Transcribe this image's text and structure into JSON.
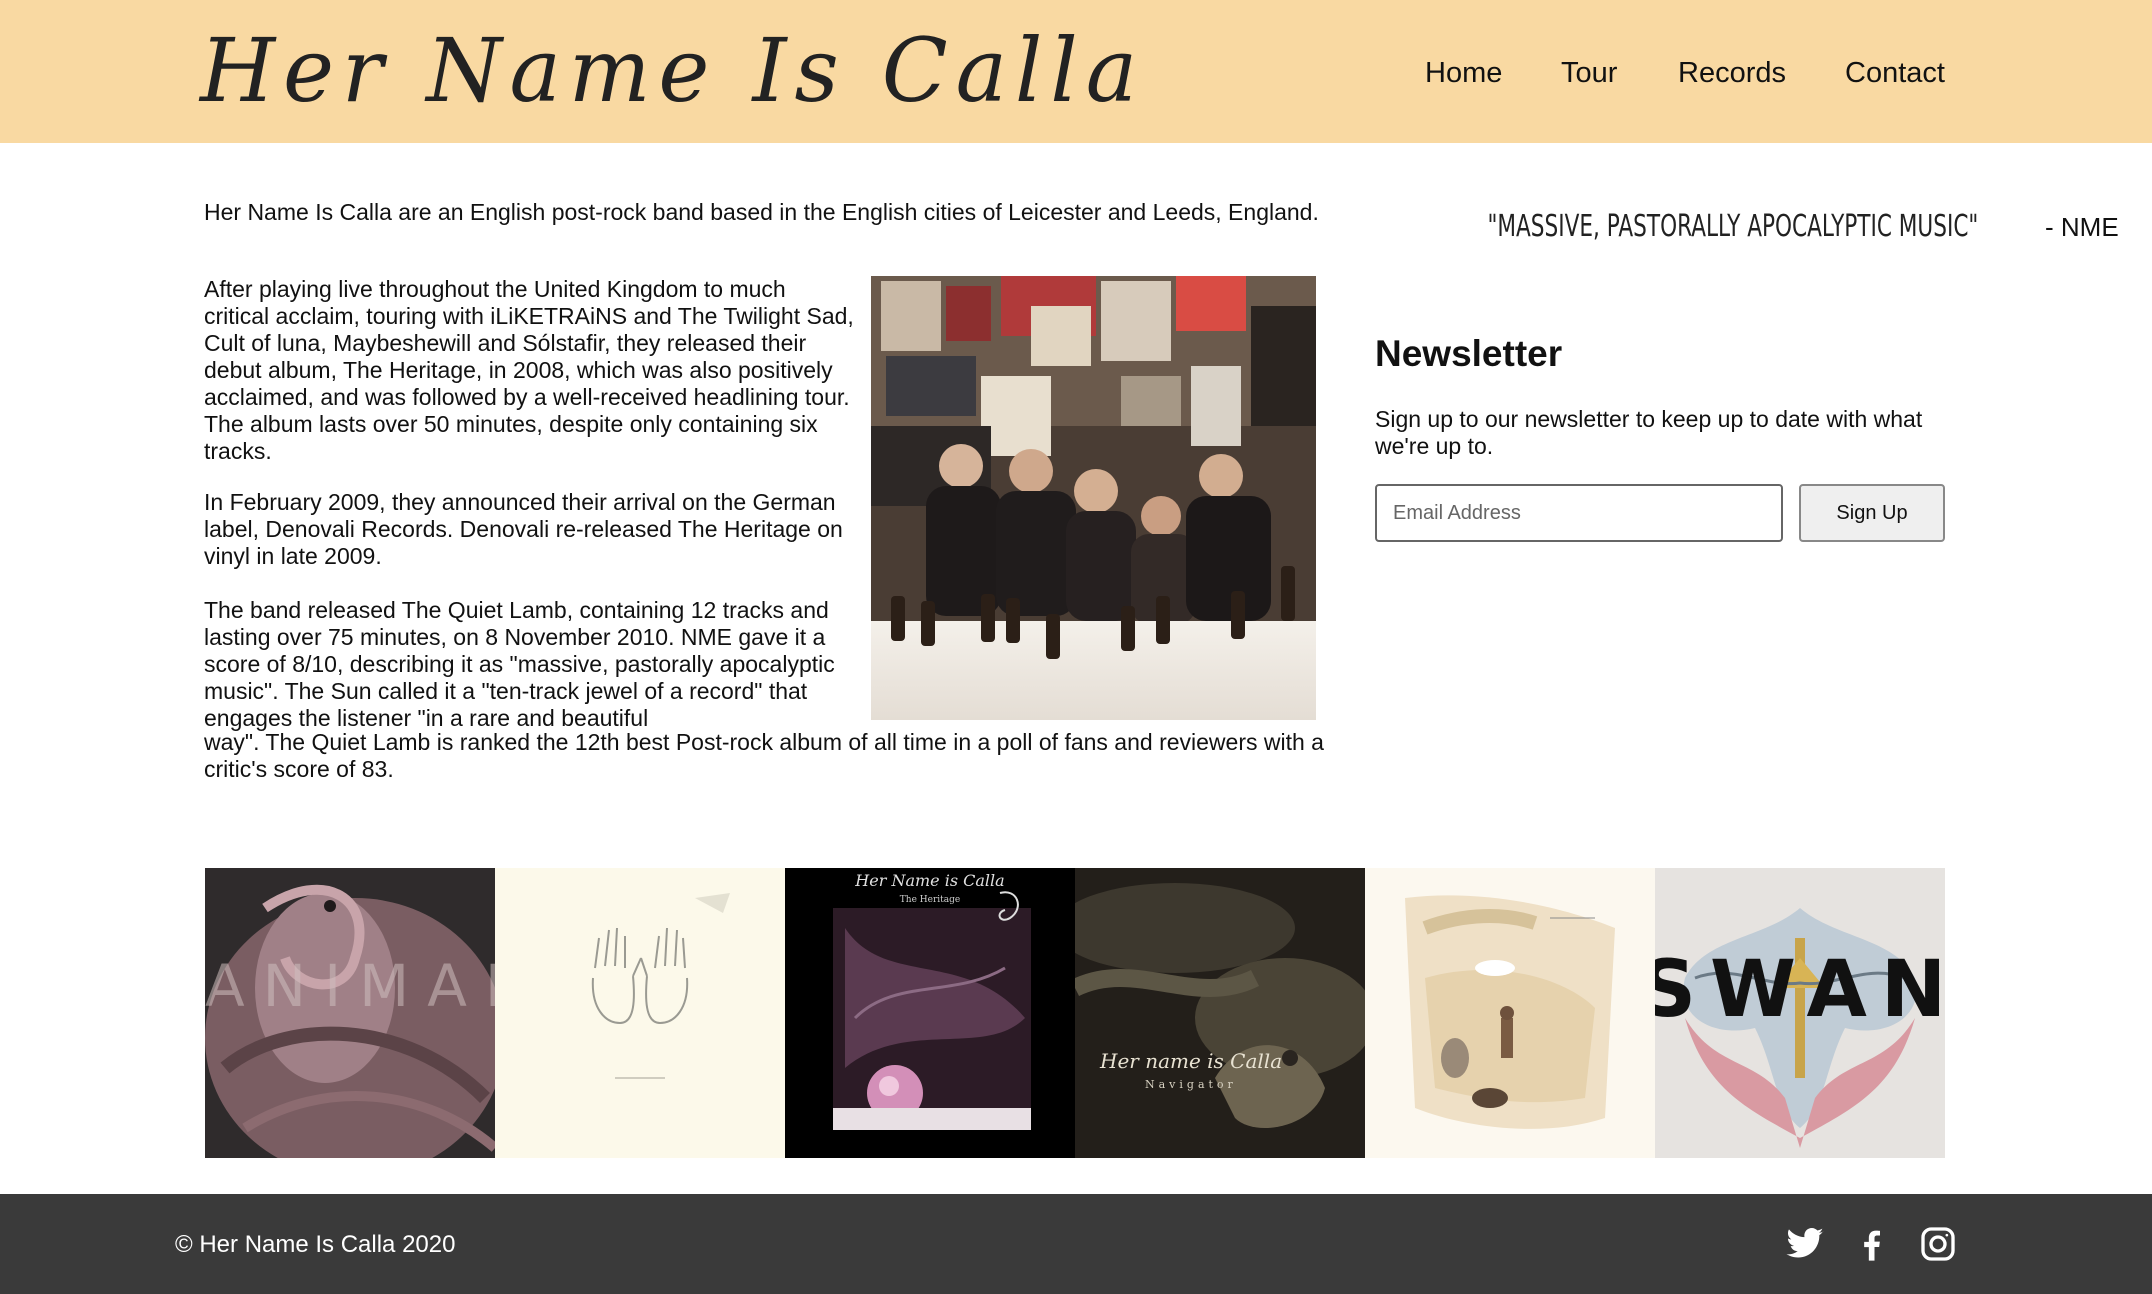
{
  "header": {
    "logo_text": "Her Name Is Calla",
    "nav": [
      "Home",
      "Tour",
      "Records",
      "Contact"
    ]
  },
  "content": {
    "intro": "Her Name Is Calla are an English post-rock band based in the English cities of Leicester and Leeds, England.",
    "p2": "After playing live throughout the United Kingdom to much critical acclaim, touring with iLiKETRAiNS and The Twilight Sad, Cult of luna, Maybeshewill and Sólstafir, they released their debut album, The Heritage, in 2008, which was also positively acclaimed, and was followed by a well-received headlining tour. The album lasts over 50 minutes, despite only containing six tracks.",
    "p3": "In February 2009, they announced their arrival on the German label, Denovali Records. Denovali re-released The Heritage on vinyl in late 2009.",
    "p4a": "The band released The Quiet Lamb, containing 12 tracks and lasting over 75 minutes, on 8 November 2010. NME gave it a score of 8/10, describing it as \"massive, pastorally apocalyptic music\". The Sun called it a \"ten-track jewel of a record\" that engages the listener \"in a rare and beautiful",
    "p4b": "way\". The Quiet Lamb is ranked the 12th best Post-rock album of all time in a poll of fans and reviewers with a critic's score of 83."
  },
  "quote": {
    "text": "\"MASSIVE, PASTORALLY APOCALYPTIC MUSIC\"",
    "source": " - NME"
  },
  "newsletter": {
    "title": "Newsletter",
    "description": "Sign up to our newsletter to keep up to date with what we're up to.",
    "email_placeholder": "Email Address",
    "button": "Sign Up"
  },
  "albums": {
    "animal_choir": "ANIMAL CHOIR",
    "heritage_band": "Her Name is Calla",
    "heritage_title": "The Heritage",
    "navigator_band": "Her name is Calla",
    "navigator_title": "Navigator",
    "swan": "SWAN"
  },
  "footer": {
    "copyright": "© Her Name Is Calla 2020",
    "social": [
      "twitter-icon",
      "facebook-icon",
      "instagram-icon"
    ]
  },
  "colors": {
    "header_bg": "#f9d9a2",
    "footer_bg": "#3a3a3a"
  }
}
